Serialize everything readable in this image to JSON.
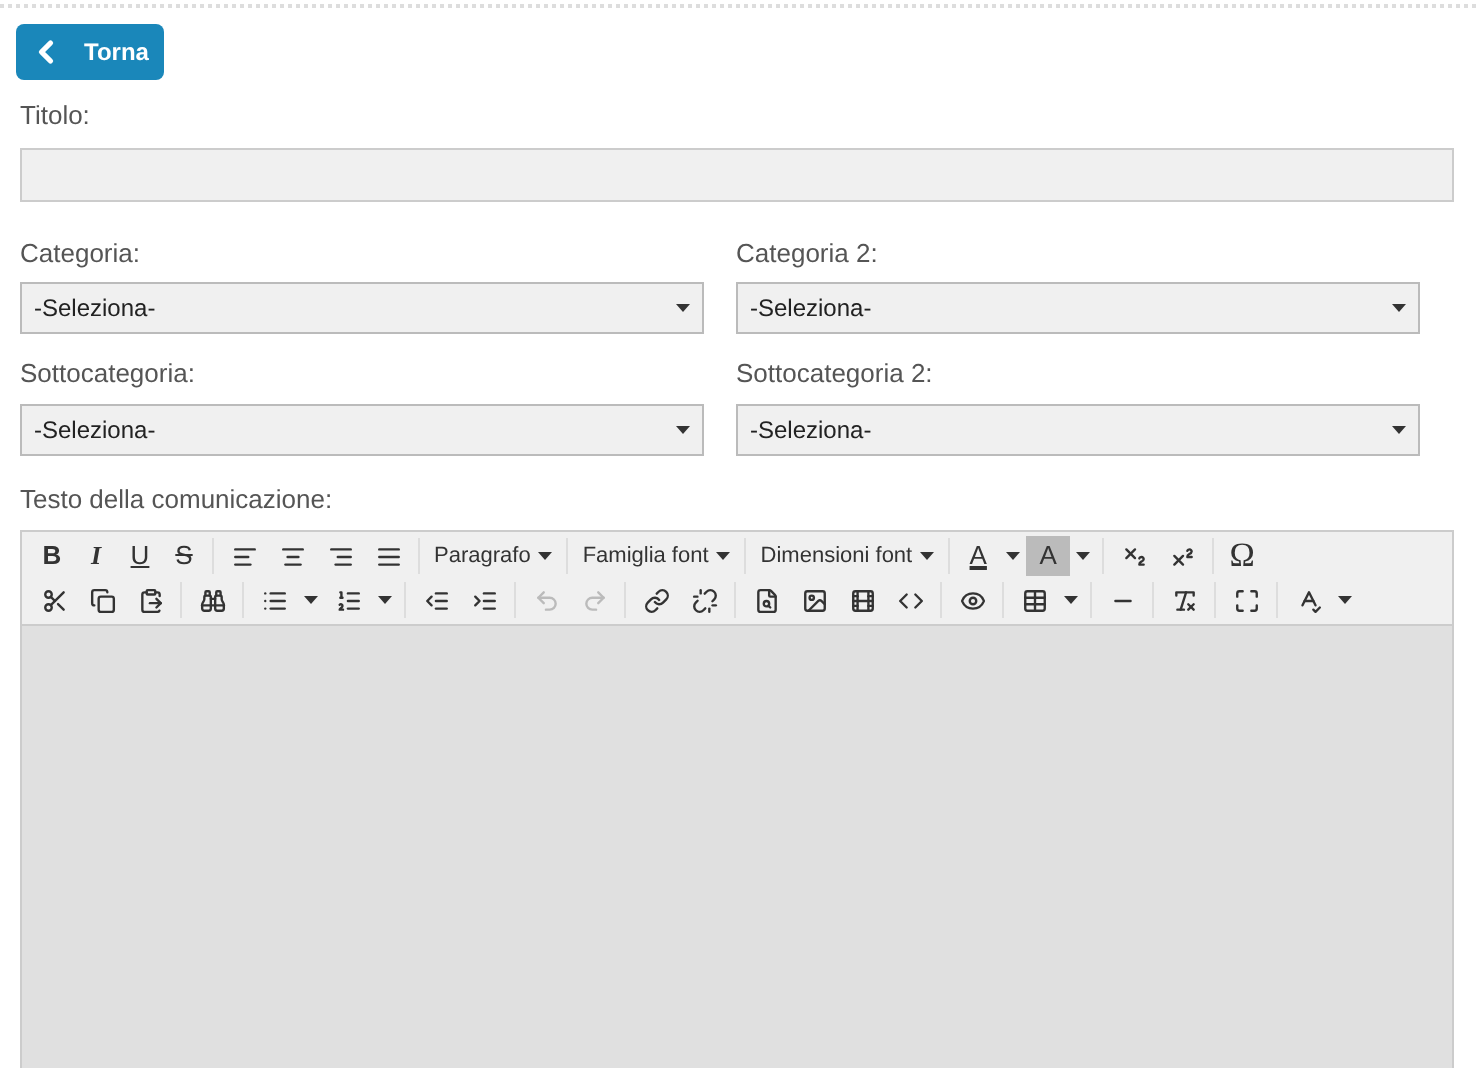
{
  "back_button": {
    "label": "Torna"
  },
  "title_field": {
    "label": "Titolo:"
  },
  "selects": [
    [
      {
        "label": "Categoria:",
        "value": "-Seleziona-"
      },
      {
        "label": "Categoria 2:",
        "value": "-Seleziona-"
      }
    ],
    [
      {
        "label": "Sottocategoria:",
        "value": "-Seleziona-"
      },
      {
        "label": "Sottocategoria 2:",
        "value": "-Seleziona-"
      }
    ]
  ],
  "editor": {
    "label": "Testo della comunicazione:",
    "toolbar_rows": [
      [
        {
          "kind": "text",
          "label": "B"
        },
        {
          "kind": "text",
          "label": "I"
        },
        {
          "kind": "text",
          "label": "U"
        },
        {
          "kind": "text",
          "label": "S"
        },
        {
          "kind": "separator"
        },
        {
          "kind": "icon"
        },
        {
          "kind": "icon"
        },
        {
          "kind": "icon"
        },
        {
          "kind": "icon"
        },
        {
          "kind": "separator"
        },
        {
          "kind": "dropdown",
          "label": "Paragrafo"
        },
        {
          "kind": "separator"
        },
        {
          "kind": "dropdown",
          "label": "Famiglia font"
        },
        {
          "kind": "separator"
        },
        {
          "kind": "dropdown",
          "label": "Dimensioni font"
        },
        {
          "kind": "separator"
        },
        {
          "kind": "text",
          "label": "A"
        },
        {
          "kind": "caret"
        },
        {
          "kind": "text",
          "label": "A"
        },
        {
          "kind": "caret"
        },
        {
          "kind": "separator"
        },
        {
          "kind": "icon"
        },
        {
          "kind": "icon"
        },
        {
          "kind": "separator"
        },
        {
          "kind": "text",
          "label": "Ω"
        }
      ],
      [
        {
          "kind": "icon"
        },
        {
          "kind": "icon"
        },
        {
          "kind": "icon"
        },
        {
          "kind": "separator"
        },
        {
          "kind": "icon"
        },
        {
          "kind": "separator"
        },
        {
          "kind": "icon"
        },
        {
          "kind": "caret"
        },
        {
          "kind": "icon"
        },
        {
          "kind": "caret"
        },
        {
          "kind": "separator"
        },
        {
          "kind": "icon"
        },
        {
          "kind": "icon"
        },
        {
          "kind": "separator"
        },
        {
          "kind": "icon",
          "disabled": true
        },
        {
          "kind": "icon",
          "disabled": true
        },
        {
          "kind": "separator"
        },
        {
          "kind": "icon"
        },
        {
          "kind": "icon"
        },
        {
          "kind": "separator"
        },
        {
          "kind": "icon"
        },
        {
          "kind": "icon"
        },
        {
          "kind": "icon"
        },
        {
          "kind": "icon"
        },
        {
          "kind": "separator"
        },
        {
          "kind": "icon"
        },
        {
          "kind": "separator"
        },
        {
          "kind": "icon"
        },
        {
          "kind": "caret"
        },
        {
          "kind": "separator"
        },
        {
          "kind": "icon"
        },
        {
          "kind": "separator"
        },
        {
          "kind": "icon"
        },
        {
          "kind": "separator"
        },
        {
          "kind": "icon"
        },
        {
          "kind": "separator"
        },
        {
          "kind": "icon"
        },
        {
          "kind": "caret"
        }
      ]
    ]
  }
}
